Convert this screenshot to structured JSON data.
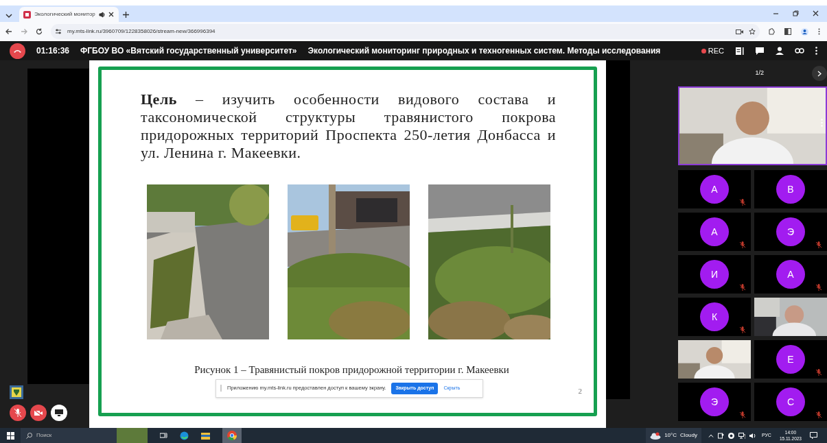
{
  "browser": {
    "tabs": [
      {
        "title": "Экологический монитор",
        "selected": true
      }
    ],
    "url": "my.mts-link.ru/3960709/1228358026/stream-new/366996394"
  },
  "meeting": {
    "timer": "01:16:36",
    "organization": "ФГБОУ ВО «Вятский государственный университет»",
    "title": "Экологический мониторинг природных и техногенных систем. Методы исследования",
    "rec": "REC"
  },
  "slide": {
    "paragraph": "**Цель** – изучить особенности видового состава и таксономической структуры травянистого покрова придорожных территорий Проспекта 250-летия Донбасса и ул. Ленина г. Макеевки.",
    "caption": "Рисунок 1 – Травянистый покров придорожной территории г. Макеевки",
    "page_number": "2"
  },
  "share_notice": {
    "text": "Приложению my.mts-link.ru предоставлен доступ к вашему экрану.",
    "stop_button": "Закрыть доступ",
    "hide_link": "Скрыть"
  },
  "controls": {
    "mic_muted": true,
    "camera_off": true
  },
  "participants": {
    "pager": "1/2",
    "tiles": [
      {
        "kind": "avatar",
        "initial": "А",
        "muted": true
      },
      {
        "kind": "avatar",
        "initial": "В",
        "muted": false
      },
      {
        "kind": "avatar",
        "initial": "А",
        "muted": true
      },
      {
        "kind": "avatar",
        "initial": "Э",
        "muted": true
      },
      {
        "kind": "avatar",
        "initial": "И",
        "muted": true
      },
      {
        "kind": "avatar",
        "initial": "А",
        "muted": true
      },
      {
        "kind": "avatar",
        "initial": "К",
        "muted": true
      },
      {
        "kind": "video"
      },
      {
        "kind": "video"
      },
      {
        "kind": "avatar",
        "initial": "Е",
        "muted": true
      },
      {
        "kind": "avatar",
        "initial": "Э",
        "muted": true
      },
      {
        "kind": "avatar",
        "initial": "С",
        "muted": true
      }
    ]
  },
  "taskbar": {
    "search_placeholder": "Поиск",
    "temperature": "10°C",
    "weather": "Cloudy",
    "language": "РУС",
    "time": "14:00",
    "date": "15.11.2023"
  }
}
